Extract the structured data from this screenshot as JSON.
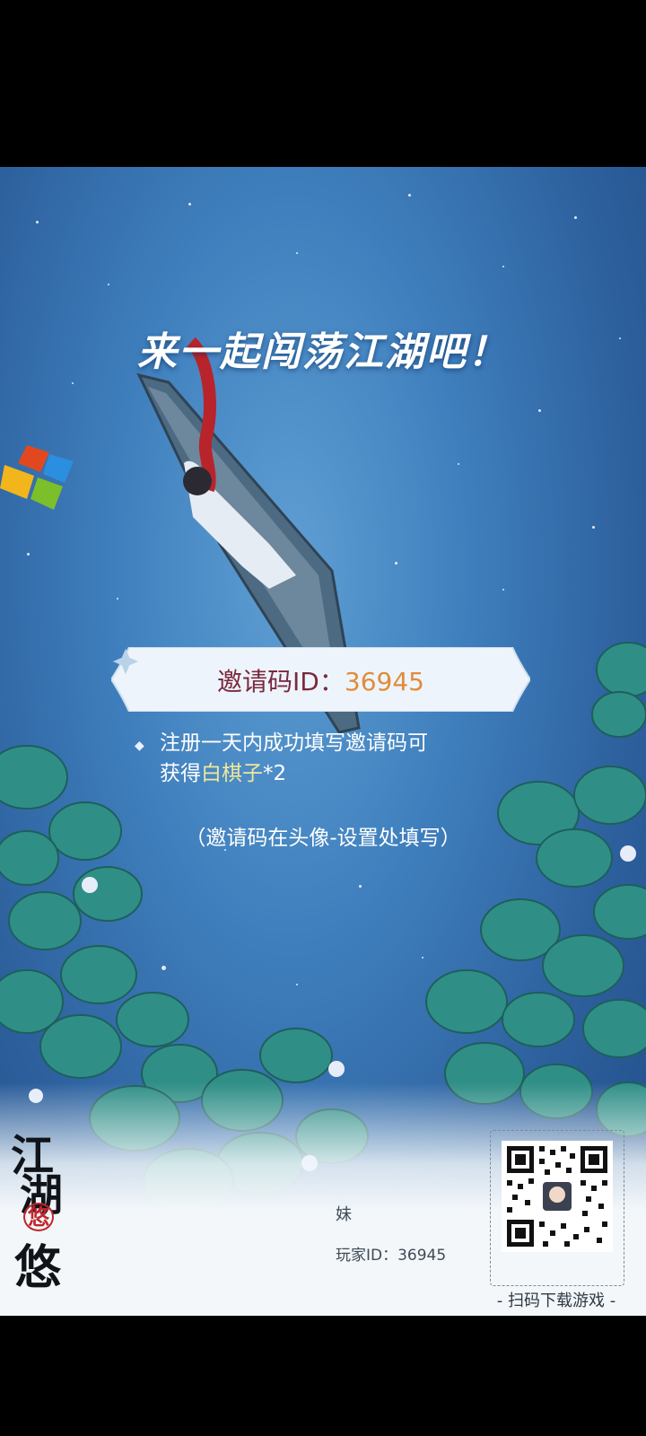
{
  "headline": "来一起闯荡江湖吧！",
  "invite": {
    "label": "邀请码ID：",
    "code": "36945"
  },
  "rule": {
    "line1": "注册一天内成功填写邀请码可",
    "line2_prefix": "获得",
    "reward_item": "白棋子",
    "reward_count": "*2"
  },
  "hint": "（邀请码在头像-设置处填写）",
  "brand": {
    "logo_text": "江湖悠悠",
    "seal_text": "悠"
  },
  "player": {
    "name": "妹",
    "id_label": "玩家ID：",
    "id_value": "36945"
  },
  "qr": {
    "caption": "扫码下载游戏"
  },
  "colors": {
    "sky": "#3f7fbd",
    "invite_label": "#7a2a3e",
    "invite_code": "#e08c3b",
    "reward": "#f0e79a"
  }
}
